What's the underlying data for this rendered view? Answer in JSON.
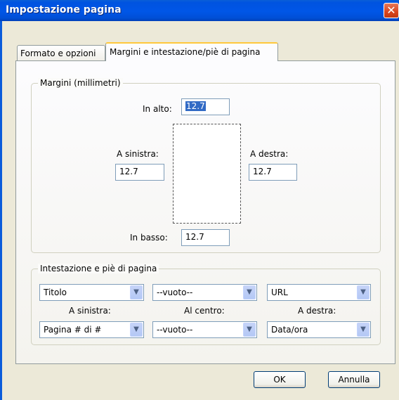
{
  "window": {
    "title": "Impostazione pagina",
    "close_glyph": "✕"
  },
  "tabs": [
    {
      "label": "Formato e opzioni"
    },
    {
      "label": "Margini e intestazione/piè di pagina"
    }
  ],
  "margins": {
    "legend": "Margini (millimetri)",
    "top": {
      "label": "In alto:",
      "value": "12.7"
    },
    "left": {
      "label": "A sinistra:",
      "value": "12.7"
    },
    "right": {
      "label": "A destra:",
      "value": "12.7"
    },
    "bottom": {
      "label": "In basso:",
      "value": "12.7"
    }
  },
  "headers_footers": {
    "legend": "Intestazione e piè di pagina",
    "header_left": "Titolo",
    "header_center": "--vuoto--",
    "header_right": "URL",
    "label_left": "A sinistra:",
    "label_center": "Al centro:",
    "label_right": "A destra:",
    "footer_left": "Pagina # di #",
    "footer_center": "--vuoto--",
    "footer_right": "Data/ora",
    "dropdown_glyph": "▼"
  },
  "buttons": {
    "ok": "OK",
    "cancel": "Annulla"
  }
}
